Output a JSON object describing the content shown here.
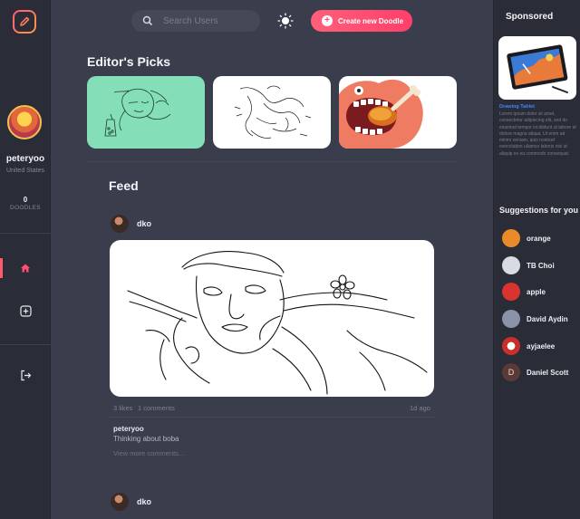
{
  "header": {
    "search_placeholder": "Search Users",
    "create_button_label": "Create new Doodle"
  },
  "profile": {
    "username": "peteryoo",
    "location": "United States",
    "doodle_count": "0",
    "doodle_label": "DOODLES"
  },
  "nav": {
    "items": [
      {
        "name": "home",
        "icon": "home-icon",
        "active": true
      },
      {
        "name": "create",
        "icon": "plus-square-icon",
        "active": false
      },
      {
        "name": "logout",
        "icon": "logout-icon",
        "active": false
      }
    ]
  },
  "editors_picks": {
    "title": "Editor's Picks"
  },
  "feed": {
    "title": "Feed",
    "posts": [
      {
        "author": "dko",
        "likes_label": "3 likes",
        "comments_label": "1 comments",
        "time_ago": "1d ago",
        "caption_user": "peteryoo",
        "caption_text": "Thinking about boba",
        "view_more_label": "View more comments..."
      },
      {
        "author": "dko"
      }
    ]
  },
  "sponsored": {
    "title": "Sponsored",
    "ad_title": "Drawing Tablet",
    "ad_body": "Lorem ipsum dolor sit amet, consectetur adipiscing elit, sed do eiusmod tempor incididunt ut labore et dolore magna aliqua. Ut enim ad minim veniam, quis nostrud exercitation ullamco laboris nisi ut aliquip ex ea commodo consequat."
  },
  "suggestions": {
    "title": "Suggestions for you",
    "users": [
      {
        "name": "orange",
        "avatar_color": "#e88a2a"
      },
      {
        "name": "TB Choi",
        "avatar_color": "#d9dbe3"
      },
      {
        "name": "apple",
        "avatar_color": "#d8332f"
      },
      {
        "name": "David Aydin",
        "avatar_color": "#8a93a8"
      },
      {
        "name": "ayjaelee",
        "avatar_color": "#c9302c"
      },
      {
        "name": "Daniel Scott",
        "avatar_color": "#5a3a37",
        "initial": "D"
      }
    ]
  },
  "colors": {
    "accent": "#ff4f70",
    "background": "#3a3d4b",
    "panel": "#2a2c38",
    "link": "#3f86ff"
  }
}
